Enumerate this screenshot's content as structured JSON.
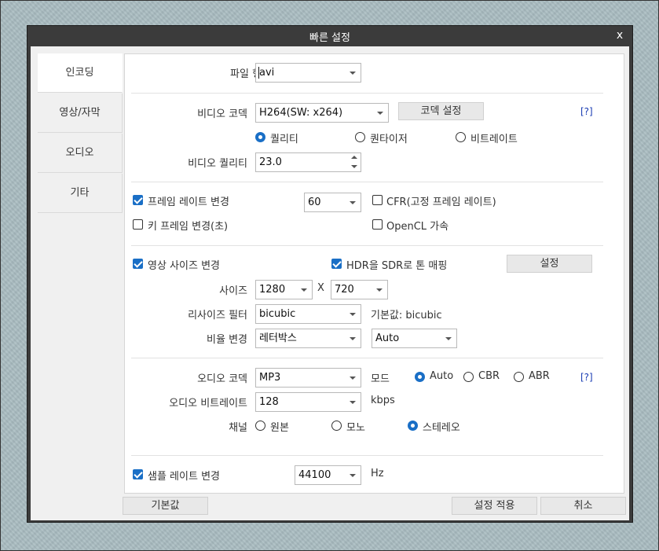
{
  "window": {
    "title": "빠른 설정",
    "close": "x"
  },
  "sidebar": {
    "items": [
      {
        "label": "인코딩"
      },
      {
        "label": "영상/자막"
      },
      {
        "label": "오디오"
      },
      {
        "label": "기타"
      }
    ]
  },
  "file": {
    "label": "파일 형식",
    "value": "avi"
  },
  "video": {
    "codec_label": "비디오 코덱",
    "codec_value": "H264(SW: x264)",
    "codec_settings": "코덱 설정",
    "help": "[?]",
    "mode_quality": "퀄리티",
    "mode_quantizer": "퀀타이저",
    "mode_bitrate": "비트레이트",
    "quality_label": "비디오 퀄리티",
    "quality_value": "23.0"
  },
  "frame": {
    "rate_change": "프레임 레이트 변경",
    "rate_value": "60",
    "cfr": "CFR(고정 프레임 레이트)",
    "keyframe": "키 프레임 변경(초)",
    "opencl": "OpenCL 가속"
  },
  "size": {
    "change": "영상 사이즈 변경",
    "hdr": "HDR을 SDR로 톤 매핑",
    "settings": "설정",
    "size_label": "사이즈",
    "width": "1280",
    "x": "X",
    "height": "720",
    "resize_label": "리사이즈 필터",
    "resize_value": "bicubic",
    "default_hint": "기본값: bicubic",
    "aspect_label": "비율 변경",
    "aspect_value": "레터박스",
    "aspect_mode": "Auto"
  },
  "audio": {
    "codec_label": "오디오 코덱",
    "codec_value": "MP3",
    "mode_label": "모드",
    "mode_auto": "Auto",
    "mode_cbr": "CBR",
    "mode_abr": "ABR",
    "help": "[?]",
    "bitrate_label": "오디오 비트레이트",
    "bitrate_value": "128",
    "bitrate_unit": "kbps",
    "channel_label": "채널",
    "ch_original": "원본",
    "ch_mono": "모노",
    "ch_stereo": "스테레오"
  },
  "sample": {
    "change": "샘플 레이트 변경",
    "value": "44100",
    "unit": "Hz"
  },
  "footer": {
    "default": "기본값",
    "apply": "설정 적용",
    "cancel": "취소"
  },
  "colors": {
    "accent": "#1a6fc6",
    "titlebar": "#3b3b3b",
    "link": "#1a3cb3"
  }
}
